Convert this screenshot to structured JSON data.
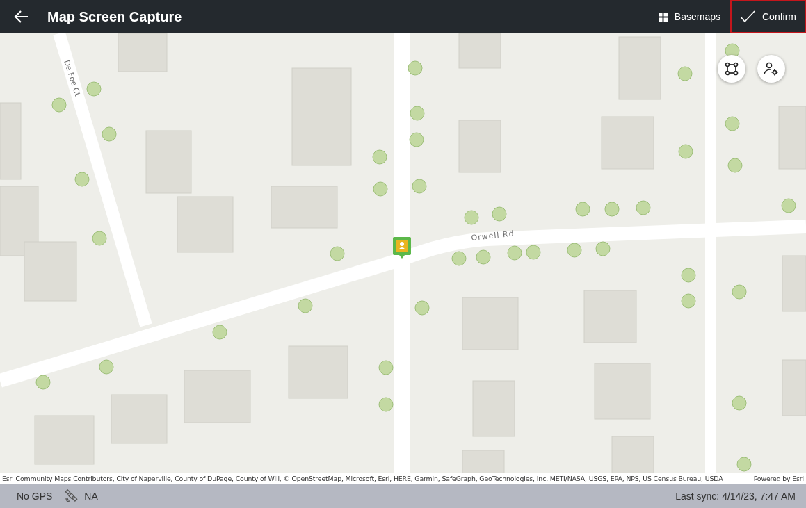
{
  "header": {
    "title": "Map Screen Capture",
    "actions": [
      {
        "kind": "basemaps",
        "label": "Basemaps",
        "focused": false
      },
      {
        "kind": "confirm",
        "label": "Confirm",
        "focused": true
      }
    ]
  },
  "map": {
    "street_labels": [
      {
        "text": "De Foe Ct"
      },
      {
        "text": "Orwell Rd"
      }
    ],
    "attribution": "Esri Community Maps Contributors, City of Naperville, County of DuPage, County of Will, © OpenStreetMap, Microsoft, Esri, HERE, Garmin, SafeGraph, GeoTechnologies, Inc, METI/NASA, USGS, EPA, NPS, US Census Bureau, USDA",
    "powered_by": "Powered by Esri"
  },
  "status_bar": {
    "gps": "No GPS",
    "accuracy": "NA",
    "last_sync": "Last sync: 4/14/23, 7:47 AM"
  }
}
